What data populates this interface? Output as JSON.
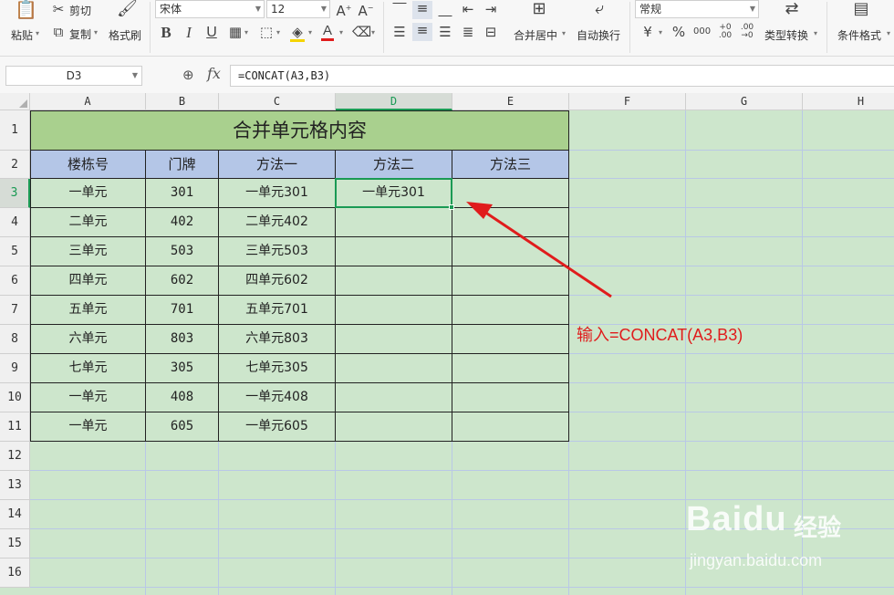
{
  "ribbon": {
    "paste": "粘贴",
    "cut": "剪切",
    "copy": "复制",
    "format_painter": "格式刷",
    "font_name": "宋体",
    "font_size": "12",
    "bold": "B",
    "italic": "I",
    "underline": "U",
    "font_color": "A",
    "merge_center": "合并居中",
    "wrap_text": "自动换行",
    "number_format": "常规",
    "currency": "¥",
    "percent": "%",
    "type_convert": "类型转换",
    "conditional_format": "条件格式"
  },
  "formula_bar": {
    "name_box": "D3",
    "fx": "fx",
    "formula": "=CONCAT(A3,B3)"
  },
  "columns": [
    "A",
    "B",
    "C",
    "D",
    "E",
    "F",
    "G",
    "H"
  ],
  "rows": [
    "1",
    "2",
    "3",
    "4",
    "5",
    "6",
    "7",
    "8",
    "9",
    "10",
    "11",
    "12",
    "13",
    "14",
    "15",
    "16"
  ],
  "table": {
    "title": "合并单元格内容",
    "headers": [
      "楼栋号",
      "门牌",
      "方法一",
      "方法二",
      "方法三"
    ],
    "rows": [
      [
        "一单元",
        "301",
        "一单元301",
        "一单元301",
        ""
      ],
      [
        "二单元",
        "402",
        "二单元402",
        "",
        ""
      ],
      [
        "三单元",
        "503",
        "三单元503",
        "",
        ""
      ],
      [
        "四单元",
        "602",
        "四单元602",
        "",
        ""
      ],
      [
        "五单元",
        "701",
        "五单元701",
        "",
        ""
      ],
      [
        "六单元",
        "803",
        "六单元803",
        "",
        ""
      ],
      [
        "七单元",
        "305",
        "七单元305",
        "",
        ""
      ],
      [
        "一单元",
        "408",
        "一单元408",
        "",
        ""
      ],
      [
        "一单元",
        "605",
        "一单元605",
        "",
        ""
      ]
    ]
  },
  "annotation": "输入=CONCAT(A3,B3)",
  "watermark": {
    "logo": "Baidu",
    "text": "经验",
    "url": "jingyan.baidu.com"
  },
  "colors": {
    "sheet_background": "#cde6cc",
    "title_fill": "#a9d08e",
    "header_fill": "#b4c6e7",
    "selection": "#1a9a54",
    "annotation": "#e01c1c"
  }
}
